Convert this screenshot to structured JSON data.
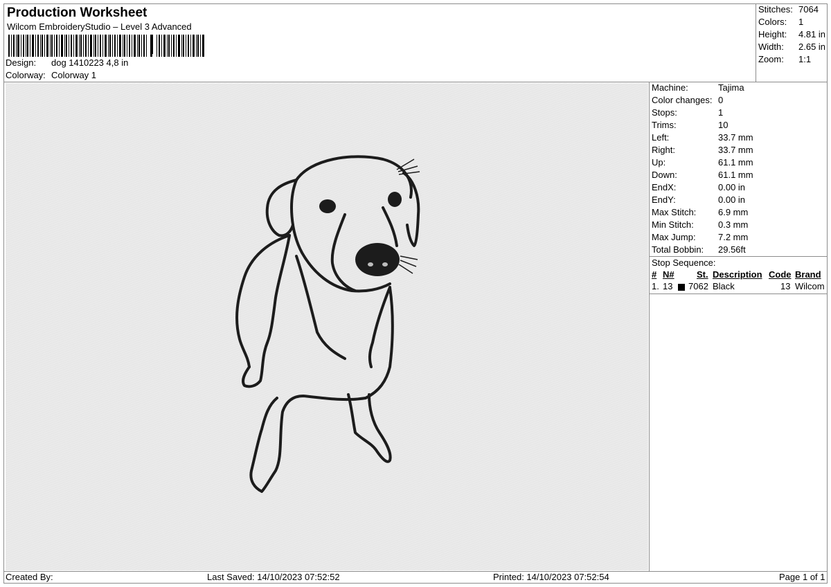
{
  "header": {
    "title": "Production Worksheet",
    "subtitle": "Wilcom EmbroideryStudio – Level 3 Advanced",
    "design_label": "Design:",
    "design_value": "dog 1410223 4,8 in",
    "colorway_label": "Colorway:",
    "colorway_value": "Colorway 1"
  },
  "stats": [
    {
      "label": "Stitches:",
      "value": "7064"
    },
    {
      "label": "Colors:",
      "value": "1"
    },
    {
      "label": "Height:",
      "value": "4.81 in"
    },
    {
      "label": "Width:",
      "value": "2.65 in"
    },
    {
      "label": "Zoom:",
      "value": "1:1"
    }
  ],
  "machine_info": [
    {
      "label": "Machine:",
      "value": "Tajima"
    },
    {
      "label": "Color changes:",
      "value": "0"
    },
    {
      "label": "Stops:",
      "value": "1"
    },
    {
      "label": "Trims:",
      "value": "10"
    },
    {
      "label": "Left:",
      "value": "33.7 mm"
    },
    {
      "label": "Right:",
      "value": "33.7 mm"
    },
    {
      "label": "Up:",
      "value": "61.1 mm"
    },
    {
      "label": "Down:",
      "value": "61.1 mm"
    },
    {
      "label": "EndX:",
      "value": "0.00 in"
    },
    {
      "label": "EndY:",
      "value": "0.00 in"
    },
    {
      "label": "Max Stitch:",
      "value": "6.9 mm"
    },
    {
      "label": "Min Stitch:",
      "value": "0.3 mm"
    },
    {
      "label": "Max Jump:",
      "value": "7.2 mm"
    },
    {
      "label": "Total Bobbin:",
      "value": "29.56ft"
    }
  ],
  "stop_sequence": {
    "title": "Stop Sequence:",
    "headers": {
      "num": "#",
      "n": "N#",
      "st": "St.",
      "description": "Description",
      "code": "Code",
      "brand": "Brand"
    },
    "rows": [
      {
        "num": "1.",
        "n": "13",
        "color": "#000000",
        "st": "7062",
        "description": "Black",
        "code": "13",
        "brand": "Wilcom"
      }
    ]
  },
  "footer": {
    "created_by": "Created By:",
    "last_saved": "Last Saved: 14/10/2023 07:52:52",
    "printed": "Printed: 14/10/2023 07:52:54",
    "page": "Page 1 of 1"
  }
}
